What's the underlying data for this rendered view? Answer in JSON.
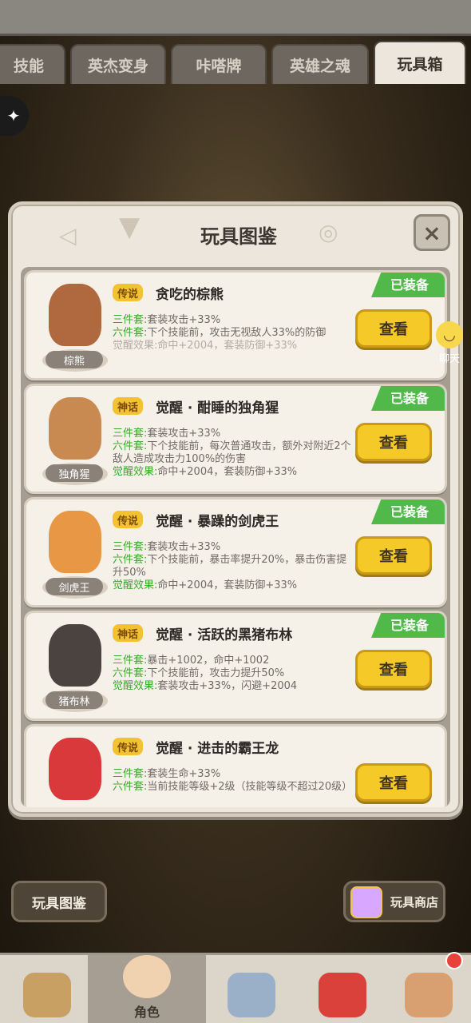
{
  "tabs": [
    "技能",
    "英杰变身",
    "咔嗒牌",
    "英雄之魂",
    "玩具箱"
  ],
  "active_tab": "玩具箱",
  "modal": {
    "title": "玩具图鉴",
    "close_label": "×"
  },
  "cards": [
    {
      "portrait_name": "棕熊",
      "rarity": "传说",
      "name": "贪吃的棕熊",
      "equipped": "已装备",
      "three_set_label": "三件套:",
      "three_set": "套装攻击+33%",
      "six_set_label": "六件套:",
      "six_set": "下个技能前，攻击无视敌人33%的防御",
      "awaken_label": "觉醒效果:",
      "awaken": "命中+2004，套装防御+33%",
      "awaken_dim": true,
      "view": "查看",
      "colors": {
        "body": "#b0683e",
        "accent": "#f4c429"
      }
    },
    {
      "portrait_name": "独角猩",
      "rarity": "神话",
      "name": "觉醒 · 酣睡的独角猩",
      "equipped": "已装备",
      "three_set_label": "三件套:",
      "three_set": "套装攻击+33%",
      "six_set_label": "六件套:",
      "six_set": "下个技能前，每次普通攻击，额外对附近2个敌人造成攻击力100%的伤害",
      "awaken_label": "觉醒效果:",
      "awaken": "命中+2004，套装防御+33%",
      "awaken_dim": false,
      "view": "查看",
      "colors": {
        "body": "#c98a52",
        "accent": "#7fc24a"
      }
    },
    {
      "portrait_name": "剑虎王",
      "rarity": "传说",
      "name": "觉醒 · 暴躁的剑虎王",
      "equipped": "已装备",
      "three_set_label": "三件套:",
      "three_set": "套装攻击+33%",
      "six_set_label": "六件套:",
      "six_set": "下个技能前，暴击率提升20%，暴击伤害提升50%",
      "awaken_label": "觉醒效果:",
      "awaken": "命中+2004，套装防御+33%",
      "awaken_dim": false,
      "view": "查看",
      "colors": {
        "body": "#e89844",
        "accent": "#3a3a3a"
      }
    },
    {
      "portrait_name": "猪布林",
      "rarity": "神话",
      "name": "觉醒 · 活跃的黑猪布林",
      "equipped": "已装备",
      "three_set_label": "三件套:",
      "three_set": "暴击+1002，命中+1002",
      "six_set_label": "六件套:",
      "six_set": "下个技能前，攻击力提升50%",
      "awaken_label": "觉醒效果:",
      "awaken": "套装攻击+33%，闪避+2004",
      "awaken_dim": false,
      "view": "查看",
      "colors": {
        "body": "#4a4340",
        "accent": "#e2a6a0"
      }
    },
    {
      "portrait_name": "",
      "rarity": "传说",
      "name": "觉醒 · 进击的霸王龙",
      "equipped": "",
      "three_set_label": "三件套:",
      "three_set": "套装生命+33%",
      "six_set_label": "六件套:",
      "six_set": "当前技能等级+2级（技能等级不超过20级）",
      "awaken_label": "",
      "awaken": "",
      "awaken_dim": false,
      "view": "查看",
      "colors": {
        "body": "#d9393a",
        "accent": "#e8dcaa"
      }
    }
  ],
  "chat": {
    "label": "聊天"
  },
  "left_button": "玩具图鉴",
  "shop_button": "玩具商店",
  "bottom_nav": [
    {
      "label": "",
      "color": "#c8a064"
    },
    {
      "label": "角色",
      "color": "#f0d2b0"
    },
    {
      "label": "",
      "color": "#9ab0c8"
    },
    {
      "label": "",
      "color": "#d9413a"
    },
    {
      "label": "",
      "color": "#d8a070"
    },
    {
      "label": "",
      "color": "#c9a56a"
    }
  ]
}
